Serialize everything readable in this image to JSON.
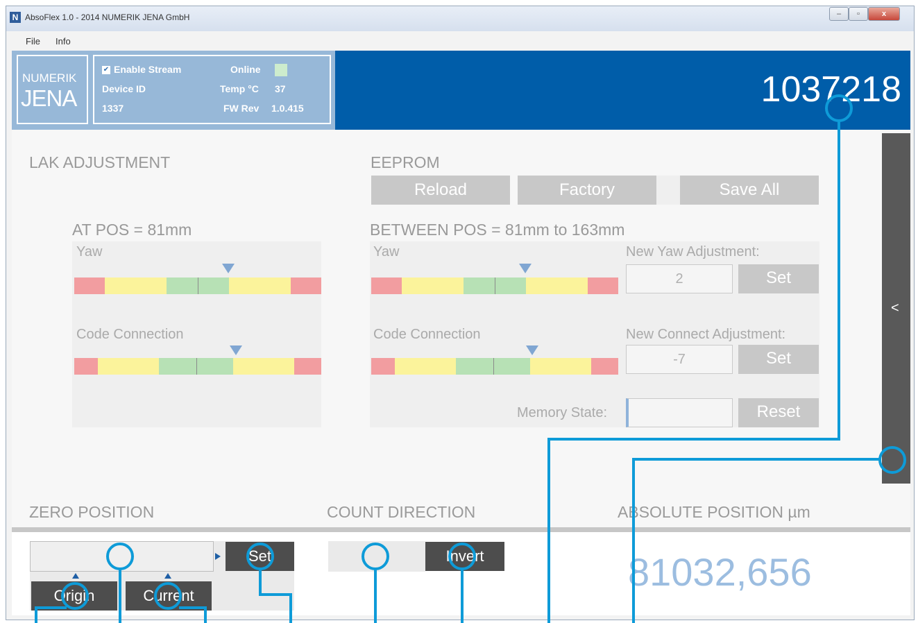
{
  "window": {
    "title": "AbsoFlex 1.0 - 2014 NUMERIK JENA GmbH",
    "app_icon": "N",
    "controls": {
      "minimize": "–",
      "maximize": "▫",
      "close": "x"
    }
  },
  "menu": {
    "items": [
      "File",
      "Info"
    ]
  },
  "header": {
    "logo_line1": "NUMERIK",
    "logo_line2": "JENA",
    "enable_stream_label": "Enable Stream",
    "enable_stream_checked": true,
    "device_id_label": "Device ID",
    "device_id_value": "1337",
    "online_label": "Online",
    "online_color": "#cdeccd",
    "temp_label": "Temp °C",
    "temp_value": "37",
    "fw_label": "FW Rev",
    "fw_value": "1.0.415",
    "counter_value": "1037218"
  },
  "lak": {
    "title": "LAK ADJUSTMENT",
    "at_pos_title": "AT POS = 81mm",
    "yaw_label": "Yaw",
    "code_connection_label": "Code Connection"
  },
  "eeprom": {
    "title": "EEPROM",
    "reload_label": "Reload",
    "factory_label": "Factory",
    "save_all_label": "Save All",
    "between_pos_title": "BETWEEN POS = 81mm to 163mm",
    "yaw_label": "Yaw",
    "code_connection_label": "Code Connection",
    "new_yaw_label": "New Yaw Adjustment:",
    "new_yaw_value": "2",
    "new_connect_label": "New Connect Adjustment:",
    "new_connect_value": "-7",
    "set_label": "Set",
    "memory_state_label": "Memory State:",
    "reset_label": "Reset"
  },
  "side_panel": {
    "toggle_label": "<"
  },
  "zero_position": {
    "title": "ZERO POSITION",
    "set_label": "Set",
    "origin_label": "Origin",
    "current_label": "Current"
  },
  "count_direction": {
    "title": "COUNT DIRECTION",
    "invert_label": "Invert"
  },
  "absolute_position": {
    "title": "ABSOLUTE POSITION µm",
    "value": "81032,656"
  },
  "colors": {
    "header_blue": "#005da9",
    "header_light_blue": "#97b8d8",
    "callout_blue": "#0e9bd8",
    "indicator_red": "#f29da0",
    "indicator_yellow": "#fbf39b",
    "indicator_green": "#b7e1b5"
  }
}
